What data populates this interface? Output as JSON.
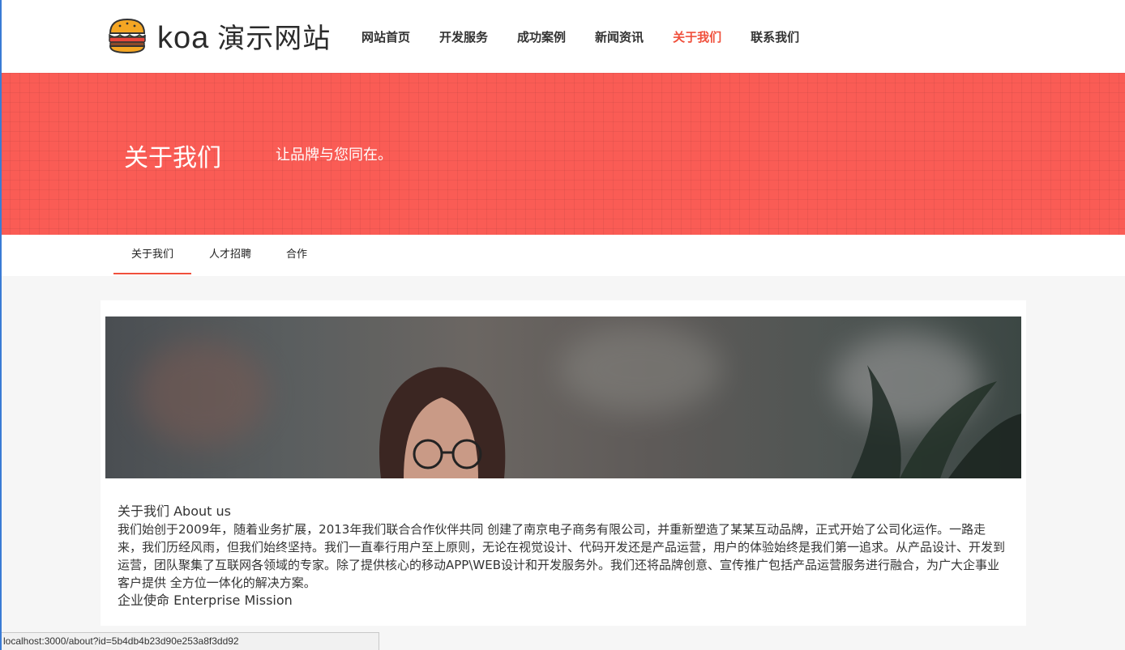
{
  "header": {
    "logo_latin": "koa",
    "logo_cn": "演示网站",
    "nav": [
      {
        "label": "网站首页"
      },
      {
        "label": "开发服务"
      },
      {
        "label": "成功案例"
      },
      {
        "label": "新闻资讯"
      },
      {
        "label": "关于我们",
        "active": true
      },
      {
        "label": "联系我们"
      }
    ]
  },
  "banner": {
    "title": "关于我们",
    "subtitle": "让品牌与您同在。"
  },
  "subnav": {
    "tabs": [
      {
        "label": "关于我们",
        "active": true
      },
      {
        "label": "人才招聘"
      },
      {
        "label": "合作"
      }
    ]
  },
  "content": {
    "about_heading": "关于我们 About us",
    "about_text": "我们始创于2009年，随着业务扩展，2013年我们联合合作伙伴共同 创建了南京电子商务有限公司，并重新塑造了某某互动品牌，正式开始了公司化运作。一路走来，我们历经风雨，但我们始终坚持。我们一直奉行用户至上原则，无论在视觉设计、代码开发还是产品运营，用户的体验始终是我们第一追求。从产品设计、开发到运营，团队聚集了互联网各领域的专家。除了提供核心的移动APP\\WEB设计和开发服务外。我们还将品牌创意、宣传推广包括产品运营服务进行融合，为广大企事业客户提供 全方位一体化的解决方案。",
    "mission_heading": "企业使命 Enterprise Mission"
  },
  "statusbar": {
    "url": "localhost:3000/about?id=5b4db4b23d90e253a8f3dd92"
  },
  "colors": {
    "accent": "#f0503c",
    "banner": "#fa5c55"
  }
}
